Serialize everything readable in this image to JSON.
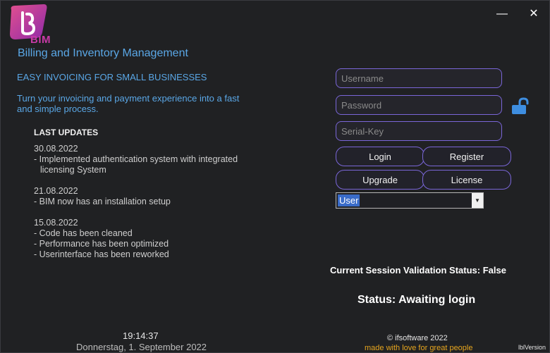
{
  "app": {
    "logo_text": "BIM",
    "title": "Billing and Inventory Management",
    "tagline": "EASY INVOICING FOR SMALL BUSINESSES",
    "description": "Turn your invoicing and payment experience into a fast and simple process."
  },
  "window_controls": {
    "minimize": "—",
    "close": "✕"
  },
  "updates": {
    "title": "LAST UPDATES",
    "blocks": [
      {
        "date": "30.08.2022",
        "lines": [
          "- Implemented authentication system with integrated",
          "licensing System"
        ]
      },
      {
        "date": "21.08.2022",
        "lines": [
          "- BIM now has an installation setup"
        ]
      },
      {
        "date": "15.08.2022",
        "lines": [
          "- Code has been cleaned",
          "- Performance has been optimized",
          "- Userinterface has been reworked"
        ]
      }
    ]
  },
  "login": {
    "username_placeholder": "Username",
    "password_placeholder": "Password",
    "serial_placeholder": "Serial-Key",
    "login_label": "Login",
    "register_label": "Register",
    "upgrade_label": "Upgrade",
    "license_label": "License",
    "role_selected": "User",
    "lock_icon": "unlock-icon"
  },
  "status": {
    "session": "Current Session Validation Status: False",
    "login": "Status: Awaiting login"
  },
  "footer": {
    "time": "19:14:37",
    "date": "Donnerstag, 1. September 2022",
    "copyright": "© ifsoftware 2022",
    "made_with": "made with love for great people",
    "version": "lblVersion"
  },
  "colors": {
    "background": "#202123",
    "accent_blue": "#5aa7e6",
    "border_purple": "#7a66d8",
    "logo_pink": "#c83aa6",
    "made_with_orange": "#e6a51e"
  }
}
